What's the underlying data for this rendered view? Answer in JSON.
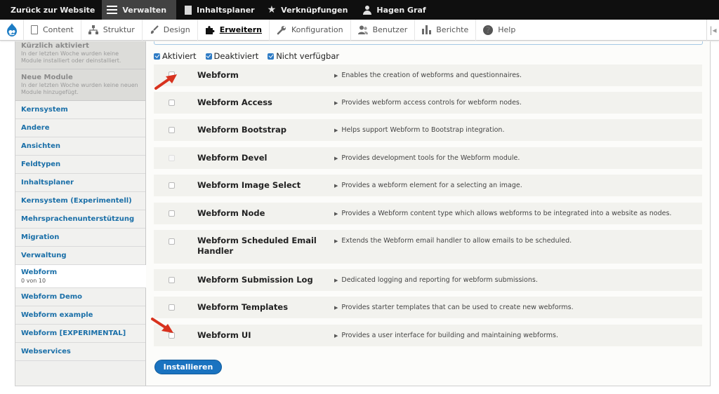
{
  "toolbar": {
    "back": "Zurück zur Website",
    "manage": "Verwalten",
    "planner": "Inhaltsplaner",
    "shortcuts": "Verknüpfungen",
    "user": "Hagen Graf"
  },
  "tray": {
    "items": [
      {
        "label": "Content",
        "icon": "file-icon"
      },
      {
        "label": "Struktur",
        "icon": "sitemap-icon"
      },
      {
        "label": "Design",
        "icon": "paintbrush-icon"
      },
      {
        "label": "Erweitern",
        "icon": "puzzle-icon",
        "active": true
      },
      {
        "label": "Konfiguration",
        "icon": "wrench-icon"
      },
      {
        "label": "Benutzer",
        "icon": "people-icon"
      },
      {
        "label": "Berichte",
        "icon": "bar-chart-icon"
      },
      {
        "label": "Help",
        "icon": "help-icon"
      }
    ]
  },
  "sidebar": {
    "recent": {
      "title": "Kürzlich aktiviert",
      "text": "In der letzten Woche wurden keine Module installiert oder deinstalliert."
    },
    "new_modules": {
      "title": "Neue Module",
      "text": "In der letzten Woche wurden keine neuen Module hinzugefügt."
    },
    "items": [
      "Kernsystem",
      "Andere",
      "Ansichten",
      "Feldtypen",
      "Inhaltsplaner",
      "Kernsystem (Experimentell)",
      "Mehrsprachenunterstützung",
      "Migration",
      "Verwaltung"
    ],
    "selected": {
      "label": "Webform",
      "count": "0 von 10"
    },
    "items_after": [
      "Webform Demo",
      "Webform example",
      "Webform [EXPERIMENTAL]",
      "Webservices"
    ]
  },
  "filters": [
    "Aktiviert",
    "Deaktiviert",
    "Nicht verfügbar"
  ],
  "modules": [
    {
      "name": "Webform",
      "desc": "Enables the creation of webforms and questionnaires."
    },
    {
      "name": "Webform Access",
      "desc": "Provides webform access controls for webform nodes."
    },
    {
      "name": "Webform Bootstrap",
      "desc": "Helps support Webform to Bootstrap integration."
    },
    {
      "name": "Webform Devel",
      "desc": "Provides development tools for the Webform module."
    },
    {
      "name": "Webform Image Select",
      "desc": "Provides a webform element for a selecting an image."
    },
    {
      "name": "Webform Node",
      "desc": "Provides a Webform content type which allows webforms to be integrated into a website as nodes."
    },
    {
      "name": "Webform Scheduled Email Handler",
      "desc": "Extends the Webform email handler to allow emails to be scheduled."
    },
    {
      "name": "Webform Submission Log",
      "desc": "Dedicated logging and reporting for webform submissions."
    },
    {
      "name": "Webform Templates",
      "desc": "Provides starter templates that can be used to create new webforms."
    },
    {
      "name": "Webform UI",
      "desc": "Provides a user interface for building and maintaining webforms."
    }
  ],
  "install_label": "Installieren",
  "colors": {
    "accent": "#1a73c0",
    "link": "#1a6fa8",
    "toolbar": "#0f0f0f",
    "arrow": "#d8321e"
  }
}
